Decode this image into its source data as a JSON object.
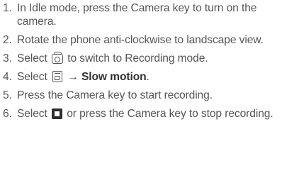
{
  "steps": [
    {
      "num": "1.",
      "text": "In Idle mode, press the Camera key to turn on the camera."
    },
    {
      "num": "2.",
      "text": "Rotate the phone anti-clockwise to landscape view."
    },
    {
      "num": "3.",
      "before": "Select",
      "after": "to switch to Recording mode.",
      "icon": "camera-switch-icon"
    },
    {
      "num": "4.",
      "before": "Select",
      "arrow": "→",
      "bold": "Slow motion",
      "end": ".",
      "icon": "menu-icon"
    },
    {
      "num": "5.",
      "text": "Press the Camera key to start recording."
    },
    {
      "num": "6.",
      "before": "Select",
      "after": "or press the Camera key to stop recording.",
      "icon": "stop-icon"
    }
  ]
}
